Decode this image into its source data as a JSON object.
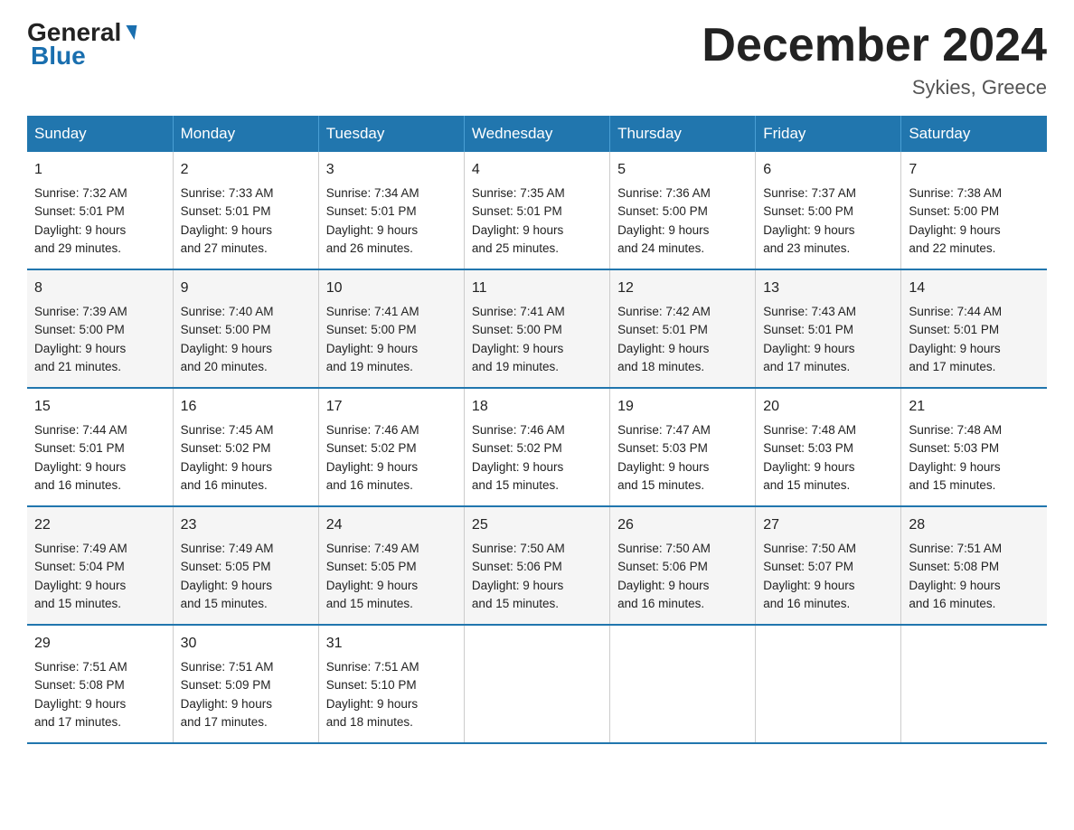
{
  "header": {
    "logo_general": "General",
    "logo_blue": "Blue",
    "month_title": "December 2024",
    "location": "Sykies, Greece"
  },
  "days_of_week": [
    "Sunday",
    "Monday",
    "Tuesday",
    "Wednesday",
    "Thursday",
    "Friday",
    "Saturday"
  ],
  "weeks": [
    [
      {
        "day": "1",
        "sunrise": "7:32 AM",
        "sunset": "5:01 PM",
        "daylight": "9 hours and 29 minutes."
      },
      {
        "day": "2",
        "sunrise": "7:33 AM",
        "sunset": "5:01 PM",
        "daylight": "9 hours and 27 minutes."
      },
      {
        "day": "3",
        "sunrise": "7:34 AM",
        "sunset": "5:01 PM",
        "daylight": "9 hours and 26 minutes."
      },
      {
        "day": "4",
        "sunrise": "7:35 AM",
        "sunset": "5:01 PM",
        "daylight": "9 hours and 25 minutes."
      },
      {
        "day": "5",
        "sunrise": "7:36 AM",
        "sunset": "5:00 PM",
        "daylight": "9 hours and 24 minutes."
      },
      {
        "day": "6",
        "sunrise": "7:37 AM",
        "sunset": "5:00 PM",
        "daylight": "9 hours and 23 minutes."
      },
      {
        "day": "7",
        "sunrise": "7:38 AM",
        "sunset": "5:00 PM",
        "daylight": "9 hours and 22 minutes."
      }
    ],
    [
      {
        "day": "8",
        "sunrise": "7:39 AM",
        "sunset": "5:00 PM",
        "daylight": "9 hours and 21 minutes."
      },
      {
        "day": "9",
        "sunrise": "7:40 AM",
        "sunset": "5:00 PM",
        "daylight": "9 hours and 20 minutes."
      },
      {
        "day": "10",
        "sunrise": "7:41 AM",
        "sunset": "5:00 PM",
        "daylight": "9 hours and 19 minutes."
      },
      {
        "day": "11",
        "sunrise": "7:41 AM",
        "sunset": "5:00 PM",
        "daylight": "9 hours and 19 minutes."
      },
      {
        "day": "12",
        "sunrise": "7:42 AM",
        "sunset": "5:01 PM",
        "daylight": "9 hours and 18 minutes."
      },
      {
        "day": "13",
        "sunrise": "7:43 AM",
        "sunset": "5:01 PM",
        "daylight": "9 hours and 17 minutes."
      },
      {
        "day": "14",
        "sunrise": "7:44 AM",
        "sunset": "5:01 PM",
        "daylight": "9 hours and 17 minutes."
      }
    ],
    [
      {
        "day": "15",
        "sunrise": "7:44 AM",
        "sunset": "5:01 PM",
        "daylight": "9 hours and 16 minutes."
      },
      {
        "day": "16",
        "sunrise": "7:45 AM",
        "sunset": "5:02 PM",
        "daylight": "9 hours and 16 minutes."
      },
      {
        "day": "17",
        "sunrise": "7:46 AM",
        "sunset": "5:02 PM",
        "daylight": "9 hours and 16 minutes."
      },
      {
        "day": "18",
        "sunrise": "7:46 AM",
        "sunset": "5:02 PM",
        "daylight": "9 hours and 15 minutes."
      },
      {
        "day": "19",
        "sunrise": "7:47 AM",
        "sunset": "5:03 PM",
        "daylight": "9 hours and 15 minutes."
      },
      {
        "day": "20",
        "sunrise": "7:48 AM",
        "sunset": "5:03 PM",
        "daylight": "9 hours and 15 minutes."
      },
      {
        "day": "21",
        "sunrise": "7:48 AM",
        "sunset": "5:03 PM",
        "daylight": "9 hours and 15 minutes."
      }
    ],
    [
      {
        "day": "22",
        "sunrise": "7:49 AM",
        "sunset": "5:04 PM",
        "daylight": "9 hours and 15 minutes."
      },
      {
        "day": "23",
        "sunrise": "7:49 AM",
        "sunset": "5:05 PM",
        "daylight": "9 hours and 15 minutes."
      },
      {
        "day": "24",
        "sunrise": "7:49 AM",
        "sunset": "5:05 PM",
        "daylight": "9 hours and 15 minutes."
      },
      {
        "day": "25",
        "sunrise": "7:50 AM",
        "sunset": "5:06 PM",
        "daylight": "9 hours and 15 minutes."
      },
      {
        "day": "26",
        "sunrise": "7:50 AM",
        "sunset": "5:06 PM",
        "daylight": "9 hours and 16 minutes."
      },
      {
        "day": "27",
        "sunrise": "7:50 AM",
        "sunset": "5:07 PM",
        "daylight": "9 hours and 16 minutes."
      },
      {
        "day": "28",
        "sunrise": "7:51 AM",
        "sunset": "5:08 PM",
        "daylight": "9 hours and 16 minutes."
      }
    ],
    [
      {
        "day": "29",
        "sunrise": "7:51 AM",
        "sunset": "5:08 PM",
        "daylight": "9 hours and 17 minutes."
      },
      {
        "day": "30",
        "sunrise": "7:51 AM",
        "sunset": "5:09 PM",
        "daylight": "9 hours and 17 minutes."
      },
      {
        "day": "31",
        "sunrise": "7:51 AM",
        "sunset": "5:10 PM",
        "daylight": "9 hours and 18 minutes."
      },
      null,
      null,
      null,
      null
    ]
  ],
  "labels": {
    "sunrise_prefix": "Sunrise: ",
    "sunset_prefix": "Sunset: ",
    "daylight_prefix": "Daylight: "
  }
}
